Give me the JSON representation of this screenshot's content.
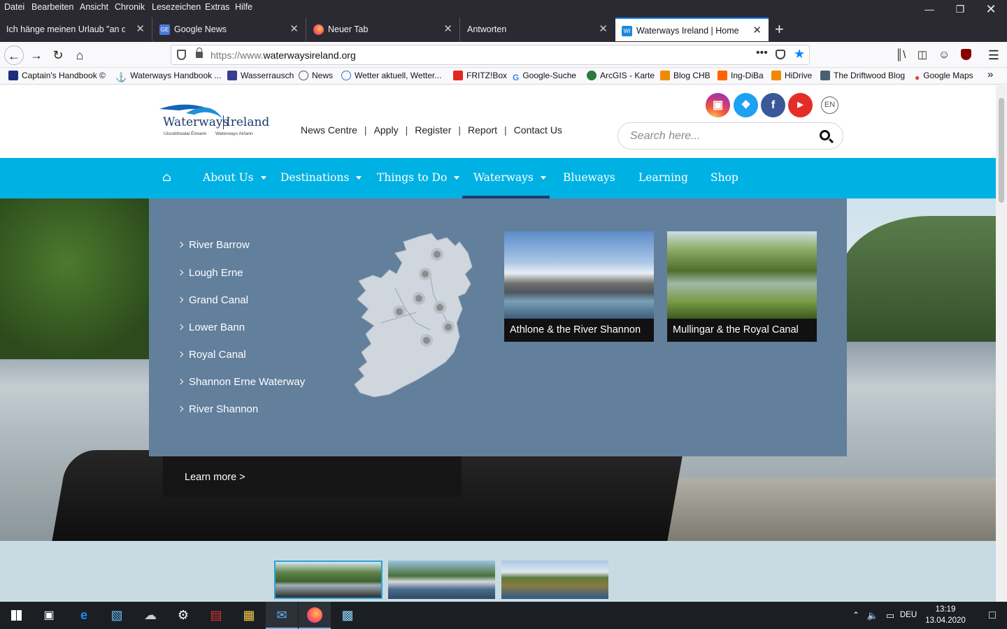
{
  "menubar": {
    "items": [
      "Datei",
      "Bearbeiten",
      "Ansicht",
      "Chronik",
      "Lesezeichen",
      "Extras",
      "Hilfe"
    ]
  },
  "tabs": [
    {
      "title": "Ich hänge meinen Urlaub \"an den"
    },
    {
      "title": "Google News"
    },
    {
      "title": "Neuer Tab"
    },
    {
      "title": "Antworten"
    },
    {
      "title": "Waterways Ireland | Home"
    }
  ],
  "urlbar": {
    "prefix": "https://www.",
    "domain": "waterwaysireland.org"
  },
  "bookmarks": [
    "Captain's Handbook ©",
    "Waterways Handbook ...",
    "Wasserrausch",
    "News",
    "Wetter aktuell, Wetter...",
    "FRITZ!Box",
    "Google-Suche",
    "ArcGIS - Karte",
    "Blog CHB",
    "Ing-DiBa",
    "HiDrive",
    "The Driftwood Blog",
    "Google Maps"
  ],
  "site": {
    "logo": {
      "name_left": "Waterways",
      "name_right": "Ireland",
      "sub_left": "Uiscebhealai Éireann",
      "sub_right": "Waterways Airlann"
    },
    "toplinks": [
      "News Centre",
      "Apply",
      "Register",
      "Report",
      "Contact Us"
    ],
    "social": {
      "lang": "EN"
    },
    "search": {
      "placeholder": "Search here..."
    },
    "nav": [
      "About Us",
      "Destinations",
      "Things to Do",
      "Waterways",
      "Blueways",
      "Learning",
      "Shop"
    ],
    "mega": {
      "waterways": [
        "River Barrow",
        "Lough Erne",
        "Grand Canal",
        "Lower Bann",
        "Royal Canal",
        "Shannon Erne Waterway",
        "River Shannon"
      ],
      "cards": [
        "Athlone & the River Shannon",
        "Mullingar & the Royal Canal"
      ]
    },
    "hero": {
      "learn_more": "Learn more >"
    },
    "colors": {
      "nav": "#00b2e3",
      "mega": "#627f9c",
      "active_underline": "#1e3c6e"
    }
  },
  "taskbar": {
    "lang": "DEU",
    "time": "13:19",
    "date": "13.04.2020"
  }
}
